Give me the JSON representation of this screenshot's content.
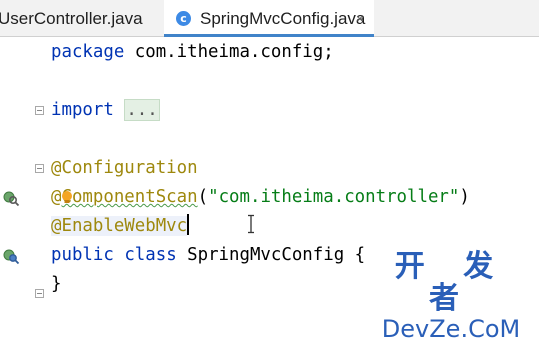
{
  "tabs": [
    {
      "label": "UserController.java",
      "active": false
    },
    {
      "label": "SpringMvcConfig.java",
      "active": true,
      "icon": "class-c-icon"
    }
  ],
  "tab_close_glyph": "×",
  "code": {
    "line1": {
      "kw": "package",
      "rest": " com.itheima.config;"
    },
    "line2": {
      "kw": "import",
      "folded": "..."
    },
    "line3": {
      "annotation": "@Configuration"
    },
    "line4": {
      "at": "@",
      "name": "ComponentScan",
      "open": "(",
      "arg": "\"com.itheima.controller\"",
      "close": ")"
    },
    "line5": {
      "annotation": "@EnableWebMvc"
    },
    "line6": {
      "kw1": "public",
      "kw2": "class",
      "rest": " SpringMvcConfig {"
    },
    "line7": {
      "text": "}"
    }
  },
  "gutter_icons": [
    "spring-bean-search-icon",
    "spring-bean-search-icon"
  ],
  "watermark": {
    "line1": "开 发 者",
    "line2": "DevZe.CoM"
  },
  "colors": {
    "keyword": "#0033b3",
    "annotation": "#9e880d",
    "string": "#067d17",
    "active_tab_underline": "#4083c9"
  }
}
